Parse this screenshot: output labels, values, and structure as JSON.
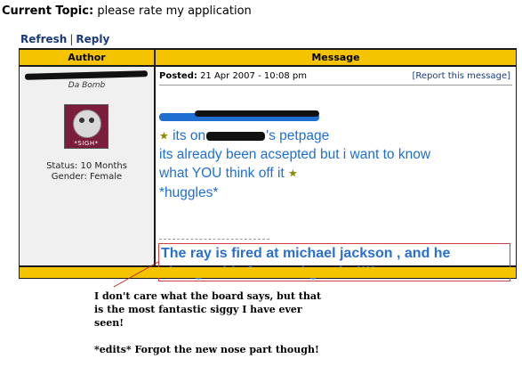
{
  "topic": {
    "label": "Current Topic:",
    "title": "please rate my application"
  },
  "actions": {
    "refresh": "Refresh",
    "separator": "|",
    "reply": "Reply"
  },
  "table": {
    "author_header": "Author",
    "message_header": "Message"
  },
  "author": {
    "rank": "Da Bomb",
    "avatar_caption": "*SIGH*",
    "status": "Status: 10 Months",
    "gender": "Gender: Female"
  },
  "post": {
    "posted_label": "Posted:",
    "posted_date": "21 Apr 2007 - 10:08 pm",
    "report": "[Report this message]",
    "line2_start": "its on",
    "line2_end": "'s petpage",
    "line3": "its already been acsepted but i want to know",
    "line4": "what YOU think off it",
    "line5": "*huggles*",
    "signature": "The ray is fired at michael jackson , and he changes his face and gender!!!!"
  },
  "annotation": {
    "line1": "I don't care what the board says, but that",
    "line2": "is the most fantastic siggy I have ever",
    "line3": "seen!",
    "line4": "*edits* Forgot the new nose part though!"
  },
  "colors": {
    "header_bar": "#f5c400",
    "body_text": "#1f6fd1",
    "signature_box": "#d04040",
    "link": "#1c3a78"
  },
  "icons": [
    "star-icon",
    "avatar-image"
  ]
}
